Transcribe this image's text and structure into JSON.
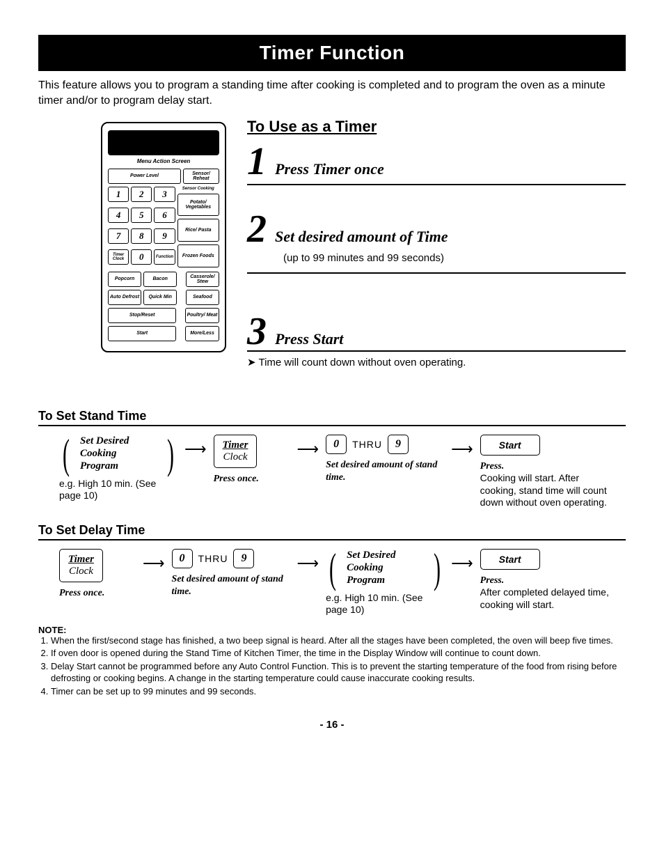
{
  "title": "Timer Function",
  "intro": "This feature allows you to program a standing time after cooking is completed and to program the oven as a minute timer and/or to program delay start.",
  "keypad": {
    "screen_label": "Menu Action Screen",
    "power": "Power Level",
    "sensor_reheat": "Sensor/ Reheat",
    "sensor_cooking": "Sensor Cooking",
    "potato": "Potato/ Vegetables",
    "rice": "Rice/ Pasta",
    "frozen": "Frozen Foods",
    "timer": "Timer Clock",
    "function": "Function",
    "popcorn": "Popcorn",
    "bacon": "Bacon",
    "casserole": "Casserole/ Stew",
    "auto_defrost": "Auto Defrost",
    "quick_min": "Quick Min",
    "seafood": "Seafood",
    "stop_reset": "Stop/Reset",
    "poultry": "Poultry/ Meat",
    "start": "Start",
    "more_less": "More/Less",
    "digits": [
      "1",
      "2",
      "3",
      "4",
      "5",
      "6",
      "7",
      "8",
      "9",
      "0"
    ]
  },
  "use_as_timer": {
    "heading": "To Use as a Timer",
    "steps": [
      {
        "n": "1",
        "text": "Press Timer once"
      },
      {
        "n": "2",
        "text": "Set desired amount of Time",
        "sub": "(up to 99 minutes and 99 seconds)"
      },
      {
        "n": "3",
        "text": "Press Start"
      }
    ],
    "bullet": "Time will count down without oven operating."
  },
  "stand_time": {
    "heading": "To Set Stand Time",
    "flow": {
      "step1_title": "Set Desired Cooking Program",
      "step1_desc": "e.g. High 10 min. (See page 10)",
      "timer_top": "Timer",
      "timer_bottom": "Clock",
      "timer_desc": "Press once.",
      "d0": "0",
      "thru": "THRU",
      "d9": "9",
      "digits_desc": "Set desired amount of stand time.",
      "start": "Start",
      "start_desc_it": "Press.",
      "start_desc": "Cooking will start. After cooking, stand time will count down without oven operating."
    }
  },
  "delay_time": {
    "heading": "To Set Delay Time",
    "flow": {
      "timer_top": "Timer",
      "timer_bottom": "Clock",
      "timer_desc": "Press once.",
      "d0": "0",
      "thru": "THRU",
      "d9": "9",
      "digits_desc": "Set desired amount of stand time.",
      "step_title": "Set Desired Cooking Program",
      "step_desc": "e.g. High 10 min. (See page 10)",
      "start": "Start",
      "start_desc_it": "Press.",
      "start_desc": "After completed delayed time, cooking will start."
    }
  },
  "notes": {
    "label": "NOTE:",
    "items": [
      "When the first/second stage has finished, a two beep signal is heard. After all the stages have been completed, the oven will beep five times.",
      "If oven door is opened during the Stand Time of Kitchen Timer, the time in the Display Window will continue to count down.",
      "Delay Start cannot be programmed before any Auto Control Function. This is to prevent the starting temperature of the food from rising before defrosting or cooking begins. A change in the starting temperature could cause inaccurate cooking results.",
      "Timer can be set up to 99 minutes and 99 seconds."
    ]
  },
  "pagenum": "- 16 -"
}
